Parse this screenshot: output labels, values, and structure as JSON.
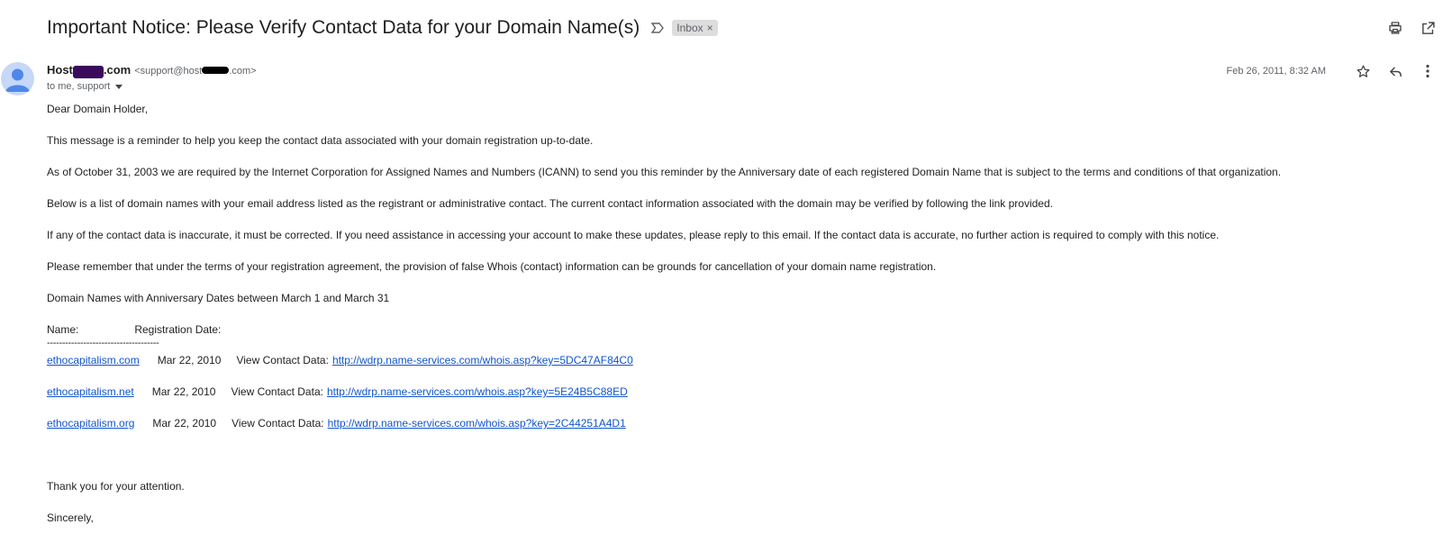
{
  "subject": "Important Notice: Please Verify Contact Data for your Domain Name(s)",
  "label": {
    "text": "Inbox",
    "remove_glyph": "×"
  },
  "toolbar_icons": [
    "print-icon",
    "open-in-new-window-icon"
  ],
  "sender": {
    "name_prefix": "Host",
    "name_suffix": ".com",
    "email_prefix": "<support@host",
    "email_suffix": ".com>",
    "recipients": "to me, support"
  },
  "meta": {
    "date": "Feb 26, 2011, 8:32 AM",
    "icons": [
      "star-icon",
      "reply-icon",
      "more-vert-icon"
    ]
  },
  "body": {
    "greeting": "Dear Domain Holder,",
    "para1": "This message is a reminder to help you keep the contact data associated with your domain registration up-to-date.",
    "para2": "As of October 31, 2003 we are required by the Internet Corporation for Assigned Names and Numbers (ICANN) to send you this reminder by the Anniversary date of each registered Domain Name that is subject to the terms and conditions of that organization.",
    "para3": "Below is a list of domain names with your email address listed as the registrant or administrative contact.  The current contact information associated with the domain may be verified by following the link provided.",
    "para4": "If any of the contact data is inaccurate, it must be corrected.  If you need assistance in accessing your account to make these updates, please reply to this email.  If the contact data is accurate, no further action is required to comply with this notice.",
    "para5": "Please remember that under the terms of your registration agreement, the provision of false Whois (contact) information can be grounds for cancellation of your domain name registration.",
    "para6": "Domain Names with Anniversary Dates between March 1 and March 31",
    "col_name": "Name:",
    "col_date": "Registration Date:",
    "dashes": "-------------------------------------",
    "view_label": "View Contact Data:",
    "domains": [
      {
        "name": "ethocapitalism.com",
        "date": "Mar 22, 2010",
        "url": "http://wdrp.name-services.com/whois.asp?key=5DC47AF84C0"
      },
      {
        "name": "ethocapitalism.net",
        "date": "Mar 22, 2010",
        "url": "http://wdrp.name-services.com/whois.asp?key=5E24B5C88ED"
      },
      {
        "name": "ethocapitalism.org",
        "date": "Mar 22, 2010",
        "url": "http://wdrp.name-services.com/whois.asp?key=2C44251A4D1"
      }
    ],
    "thanks": "Thank you for your attention.",
    "closing": "Sincerely,"
  },
  "colors": {
    "link": "#1155cc",
    "chip_bg": "#dddddd",
    "avatar_bg": "#c5d8f8",
    "avatar_fg": "#4f86ec"
  }
}
